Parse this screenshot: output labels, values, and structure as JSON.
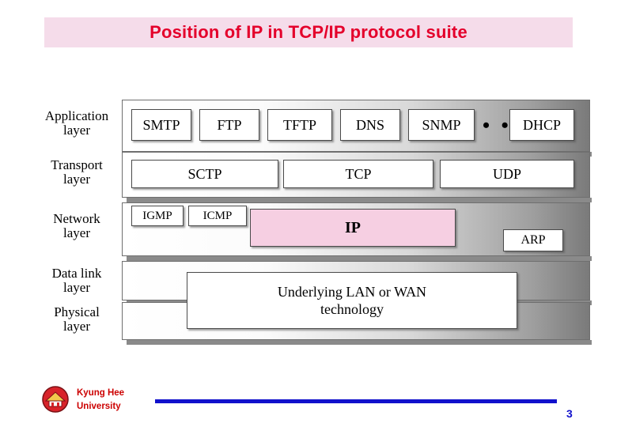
{
  "slide": {
    "title": "Position of IP in TCP/IP protocol suite"
  },
  "diagram": {
    "layers": [
      {
        "id": "application",
        "label": "Application\nlayer",
        "label_line1": "Application",
        "label_line2": "layer"
      },
      {
        "id": "transport",
        "label": "Transport\nlayer",
        "label_line1": "Transport",
        "label_line2": "layer"
      },
      {
        "id": "network",
        "label": "Network\nlayer",
        "label_line1": "Network",
        "label_line2": "layer"
      },
      {
        "id": "datalink",
        "label": "Data link\nlayer",
        "label_line1": "Data link",
        "label_line2": "layer"
      },
      {
        "id": "physical",
        "label": "Physical\nlayer",
        "label_line1": "Physical",
        "label_line2": "layer"
      }
    ],
    "application_protocols": [
      "SMTP",
      "FTP",
      "TFTP",
      "DNS",
      "SNMP",
      "DHCP"
    ],
    "application_ellipsis": "• • •",
    "transport_protocols": [
      "SCTP",
      "TCP",
      "UDP"
    ],
    "network_protocols": [
      "IGMP",
      "ICMP",
      "IP",
      "ARP"
    ],
    "network_highlight": "IP",
    "underlying_line1": "Underlying LAN or WAN",
    "underlying_line2": "technology"
  },
  "footer": {
    "org_line1": "Kyung Hee",
    "org_line2": "University",
    "page_number": "3"
  },
  "colors": {
    "title_text": "#e4002b",
    "title_band": "#f5dcea",
    "ip_highlight": "#f6cfe2",
    "footer_rule": "#1111cc",
    "footer_org": "#cc0000"
  }
}
